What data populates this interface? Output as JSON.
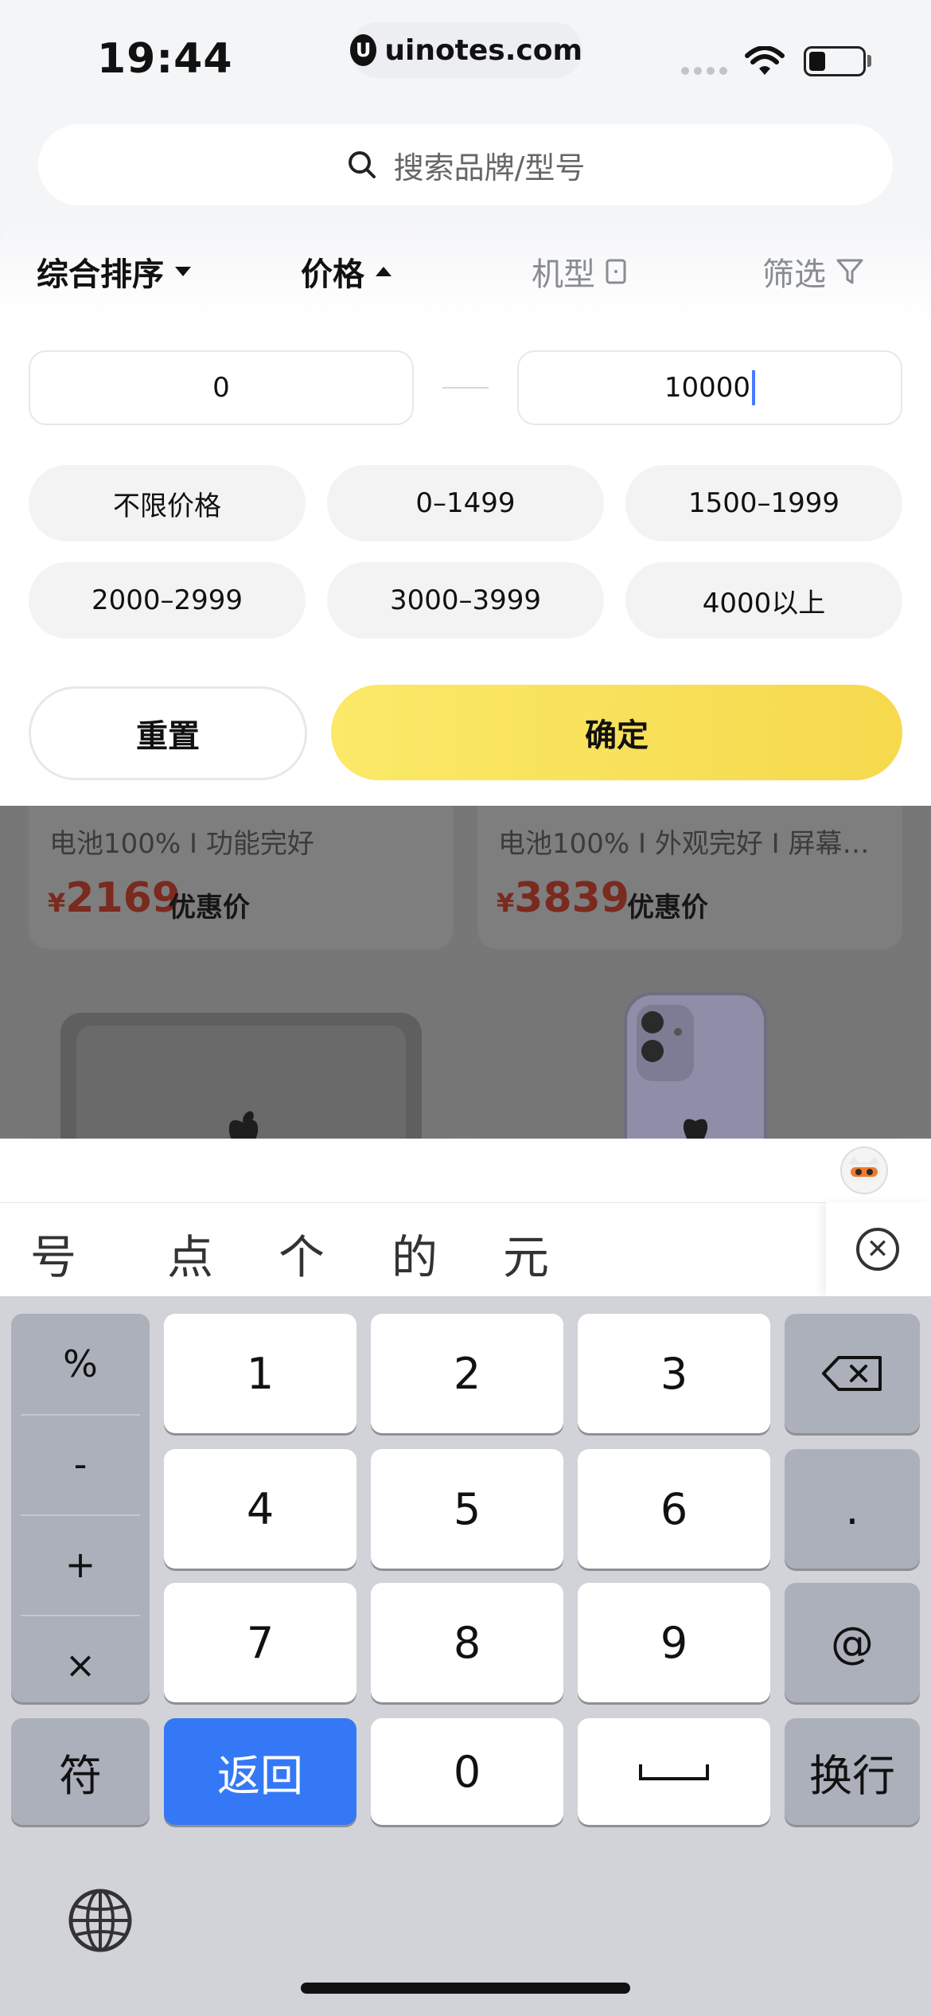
{
  "status": {
    "time": "19:44",
    "url": "uinotes.com"
  },
  "search": {
    "placeholder": "搜索品牌/型号"
  },
  "sort": {
    "overall": "综合排序",
    "price": "价格",
    "model": "机型",
    "filter": "筛选"
  },
  "price_range": {
    "min": "0",
    "max": "10000"
  },
  "chips": [
    "不限价格",
    "0–1499",
    "1500–1999",
    "2000–2999",
    "3000–3999",
    "4000以上"
  ],
  "actions": {
    "reset": "重置",
    "confirm": "确定"
  },
  "products": [
    {
      "desc": "电池100% I 功能完好",
      "currency": "¥",
      "price": "2169",
      "tag": "优惠价"
    },
    {
      "desc": "电池100% I 外观完好 I 屏幕…",
      "currency": "¥",
      "price": "3839",
      "tag": "优惠价"
    }
  ],
  "candidates": [
    "号",
    "点",
    "个",
    "的",
    "元"
  ],
  "symbols": [
    "%",
    "-",
    "+",
    "×"
  ],
  "keys": {
    "row1": [
      "1",
      "2",
      "3"
    ],
    "row2": [
      "4",
      "5",
      "6"
    ],
    "row3": [
      "7",
      "8",
      "9"
    ],
    "dot": ".",
    "at": "@",
    "fu": "符",
    "back": "返回",
    "zero": "0",
    "enter": "换行"
  },
  "colors": {
    "accent_yellow": "#f9e25b",
    "price_red": "#c0392b",
    "keyboard_blue": "#3478f6"
  }
}
